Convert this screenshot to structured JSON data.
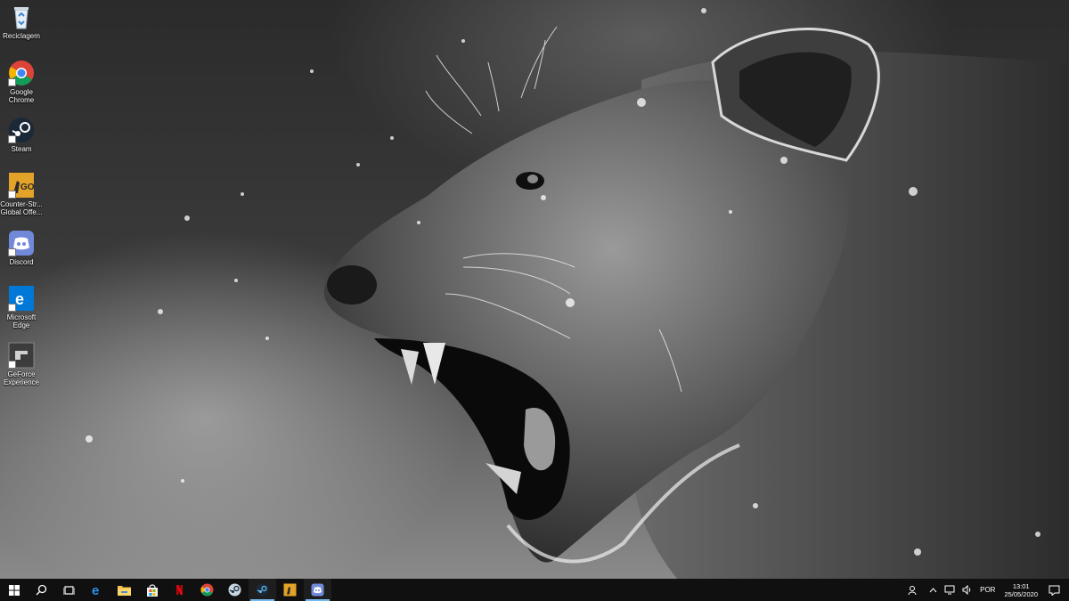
{
  "desktop": {
    "icons": [
      {
        "label": "Reciclagem",
        "icon": "recycle-bin-icon"
      },
      {
        "label": "Google Chrome",
        "icon": "chrome-icon"
      },
      {
        "label": "Steam",
        "icon": "steam-icon"
      },
      {
        "label": "Counter-Str... Global Offe...",
        "icon": "csgo-icon"
      },
      {
        "label": "Discord",
        "icon": "discord-icon"
      },
      {
        "label": "Microsoft Edge",
        "icon": "edge-icon"
      },
      {
        "label": "GeForce Experience",
        "icon": "geforce-icon"
      }
    ]
  },
  "taskbar": {
    "pinned": [
      {
        "icon": "windows-start-icon"
      },
      {
        "icon": "search-icon"
      },
      {
        "icon": "task-view-icon"
      },
      {
        "icon": "edge-icon"
      },
      {
        "icon": "file-explorer-icon"
      },
      {
        "icon": "microsoft-store-icon"
      },
      {
        "icon": "netflix-icon"
      },
      {
        "icon": "chrome-icon"
      },
      {
        "icon": "steam-icon"
      },
      {
        "icon": "steam-icon"
      },
      {
        "icon": "csgo-icon"
      },
      {
        "icon": "discord-icon"
      }
    ],
    "tray": {
      "language": "POR",
      "time": "13:01",
      "date": "25/05/2020"
    }
  },
  "colors": {
    "taskbar_bg": "#101010",
    "active_indicator": "#76b9ed",
    "chrome_red": "#db4437",
    "chrome_yellow": "#f4b400",
    "chrome_green": "#0f9d58",
    "chrome_blue": "#4285f4",
    "discord": "#7289da",
    "edge": "#0078d7",
    "netflix": "#e50914",
    "steam": "#1b2838"
  }
}
